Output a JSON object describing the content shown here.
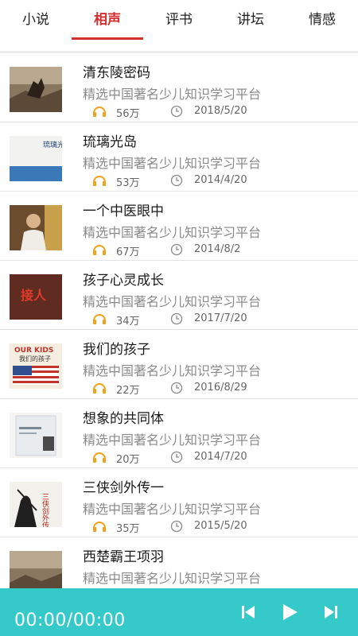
{
  "tabs": [
    {
      "label": "小说",
      "active": false
    },
    {
      "label": "相声",
      "active": true
    },
    {
      "label": "评书",
      "active": false
    },
    {
      "label": "讲坛",
      "active": false
    },
    {
      "label": "情感",
      "active": false
    }
  ],
  "items": [
    {
      "title": "清东陵密码",
      "desc": "精选中国著名少儿知识学习平台",
      "plays": "56万",
      "date": "2018/5/20"
    },
    {
      "title": "琉璃光岛",
      "desc": "精选中国著名少儿知识学习平台",
      "plays": "53万",
      "date": "2014/4/20",
      "cover_text": "琉璃光岛"
    },
    {
      "title": "一个中医眼中",
      "desc": "精选中国著名少儿知识学习平台",
      "plays": "67万",
      "date": "2014/8/2"
    },
    {
      "title": "孩子心灵成长",
      "desc": "精选中国著名少儿知识学习平台",
      "plays": "34万",
      "date": "2017/7/20",
      "cover_text": "接人"
    },
    {
      "title": "我们的孩子",
      "desc": "精选中国著名少儿知识学习平台",
      "plays": "22万",
      "date": "2016/8/29",
      "cover_text": "OUR KIDS",
      "cover_text2": "我们的孩子"
    },
    {
      "title": "想象的共同体",
      "desc": "精选中国著名少儿知识学习平台",
      "plays": "20万",
      "date": "2014/7/20"
    },
    {
      "title": "三侠剑外传一",
      "desc": "精选中国著名少儿知识学习平台",
      "plays": "35万",
      "date": "2015/5/20",
      "cover_text": "三侠剑外传"
    },
    {
      "title": "西楚霸王项羽",
      "desc": "精选中国著名少儿知识学习平台",
      "plays": "",
      "date": ""
    }
  ],
  "player": {
    "time": "00:00/00:00"
  },
  "colors": {
    "accent": "#d32f2f",
    "player_bg": "#35c9c9",
    "icon_orange": "#f4a11a"
  },
  "icons": {
    "plays": "headphones-icon",
    "date": "clock-icon",
    "prev": "skip-previous-icon",
    "play": "play-icon",
    "next": "skip-next-icon"
  }
}
